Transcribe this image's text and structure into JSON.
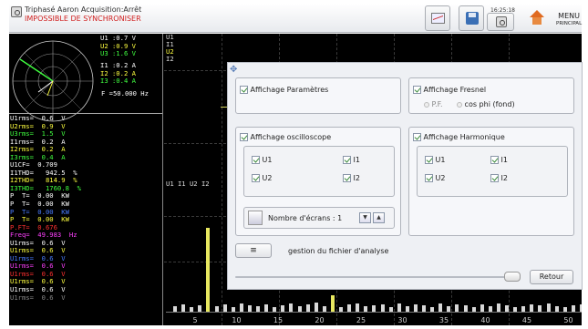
{
  "header": {
    "title": "Triphasé Aaron Acquisition:Arrêt",
    "status": "IMPOSSIBLE DE SYNCHRONISER",
    "time": "16:25:18",
    "menu_label": "MENU",
    "menu_sub": "PRINCIPAL",
    "status_color": "#d02020"
  },
  "fresnel": {
    "voltages": [
      "U1 :0.7  V",
      "U2 :0.9  V",
      "U3 :1.6  V"
    ],
    "currents": [
      "I1 :0.2  A",
      "I2 :0.2  A",
      "I3 :0.4  A"
    ],
    "frequency": "F  =50.000 Hz",
    "colors": {
      "u1": "#ffffff",
      "u2": "#ffff40",
      "u3": "#40ff40",
      "i1": "#ffffff",
      "i2": "#ffff40",
      "i3": "#40ff40"
    }
  },
  "params": [
    {
      "text": "U1rms=  0.6  V",
      "color": "#ffffff"
    },
    {
      "text": "U2rms=  0.9  V",
      "color": "#ffff40"
    },
    {
      "text": "U3rms=  1.5  V",
      "color": "#40ff40"
    },
    {
      "text": "I1rms=  0.2  A",
      "color": "#ffffff"
    },
    {
      "text": "I2rms=  0.2  A",
      "color": "#ffff40"
    },
    {
      "text": "I3rms=  0.4  A",
      "color": "#40ff40"
    },
    {
      "text": "U1CF=  0.709",
      "color": "#ffffff"
    },
    {
      "text": "I1THD=   942.5  %",
      "color": "#ffffff"
    },
    {
      "text": "I2THD=   814.9  %",
      "color": "#ffff40"
    },
    {
      "text": "I3THD=   1760.8  %",
      "color": "#40ff40"
    },
    {
      "text": "P  T=  0.00  KW",
      "color": "#ffffff"
    },
    {
      "text": "P  T=  0.00  KW",
      "color": "#ffffff"
    },
    {
      "text": "P  T=  0.00  KW",
      "color": "#4a7cff"
    },
    {
      "text": "P  T=  0.00  KW",
      "color": "#ffff40"
    },
    {
      "text": "P.FT=  0.676",
      "color": "#ff3030"
    },
    {
      "text": "Freq=  49.983  Hz",
      "color": "#ff40ff"
    },
    {
      "text": "U1rms=  0.6  V",
      "color": "#ffffff"
    },
    {
      "text": "U1rms=  0.6  V",
      "color": "#ffff40"
    },
    {
      "text": "U1rms=  0.6  V",
      "color": "#4a7cff"
    },
    {
      "text": "U1rms=  0.6  V",
      "color": "#ff40ff"
    },
    {
      "text": "U1rms=  0.6  V",
      "color": "#ff3030"
    },
    {
      "text": "U1rms=  0.6  V",
      "color": "#ffff40"
    },
    {
      "text": "U1rms=  0.6  V",
      "color": "#ffffff"
    },
    {
      "text": "U1rms=  0.6  V",
      "color": "#888888"
    }
  ],
  "waveform_labels": [
    "U1",
    "I1",
    "U2",
    "I2"
  ],
  "harmonic_label": "U1 I1 U2 I2",
  "harmonic_ticks": [
    "5",
    "10",
    "15",
    "20",
    "25",
    "30",
    "35",
    "40",
    "45",
    "50"
  ],
  "dialog": {
    "params_label": "Affichage Paramètres",
    "fresnel_label": "Affichage Fresnel",
    "pf_label": "P.F.",
    "cosphi_label": "cos phi (fond)",
    "oscillo_label": "Affichage oscilloscope",
    "harmo_label": "Affichage Harmonique",
    "osc_u1": "U1",
    "osc_i1": "I1",
    "osc_u2": "U2",
    "osc_i2": "I2",
    "har_u1": "U1",
    "har_i1": "I1",
    "har_u2": "U2",
    "har_i2": "I2",
    "screens_label": "Nombre d'écrans : 1",
    "file_label": "gestion du fichier d'analyse",
    "retour_label": "Retour"
  }
}
